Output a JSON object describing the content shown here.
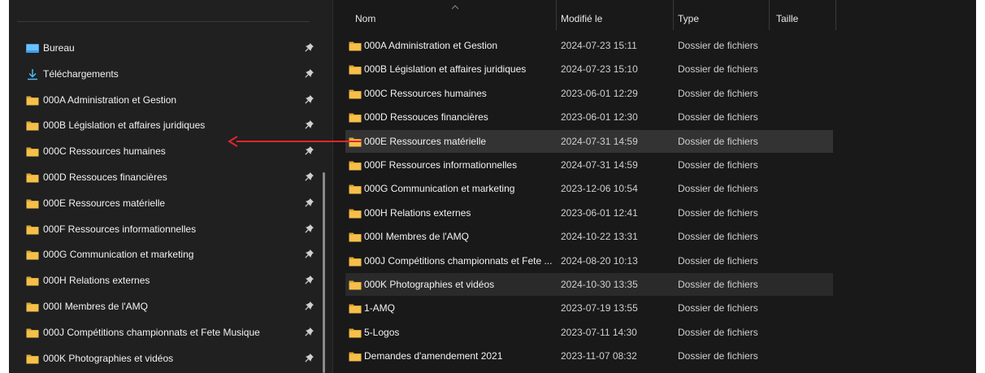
{
  "colors": {
    "folder": "#f5c04a",
    "folder_dark": "#dca734",
    "pin": "#cfcfcf",
    "download": "#4cc2ff",
    "desktop": "#3aa0f0",
    "annotation_arrow": "#e0262b"
  },
  "nav": {
    "items": [
      {
        "label": "Bureau",
        "icon": "desktop-icon"
      },
      {
        "label": "Téléchargements",
        "icon": "download-icon"
      },
      {
        "label": "000A Administration et Gestion",
        "icon": "folder-icon"
      },
      {
        "label": "000B Législation et affaires juridiques",
        "icon": "folder-icon"
      },
      {
        "label": "000C Ressources humaines",
        "icon": "folder-icon"
      },
      {
        "label": "000D Ressouces financières",
        "icon": "folder-icon"
      },
      {
        "label": "000E Ressources matérielle",
        "icon": "folder-icon"
      },
      {
        "label": "000F Ressources informationnelles",
        "icon": "folder-icon"
      },
      {
        "label": "000G Communication et marketing",
        "icon": "folder-icon"
      },
      {
        "label": "000H Relations externes",
        "icon": "folder-icon"
      },
      {
        "label": "000I Membres de l'AMQ",
        "icon": "folder-icon"
      },
      {
        "label": "000J Compétitions championnats et Fete Musique",
        "icon": "folder-icon"
      },
      {
        "label": "000K Photographies et vidéos",
        "icon": "folder-icon"
      }
    ]
  },
  "list": {
    "columns": [
      "Nom",
      "Modifié le",
      "Type",
      "Taille"
    ],
    "rows": [
      {
        "name": "000A Administration et Gestion",
        "modified": "2024-07-23 15:11",
        "type": "Dossier de fichiers"
      },
      {
        "name": "000B Législation et affaires juridiques",
        "modified": "2024-07-23 15:10",
        "type": "Dossier de fichiers"
      },
      {
        "name": "000C Ressources humaines",
        "modified": "2023-06-01 12:29",
        "type": "Dossier de fichiers"
      },
      {
        "name": "000D Ressouces financières",
        "modified": "2023-06-01 12:30",
        "type": "Dossier de fichiers"
      },
      {
        "name": "000E Ressources matérielle",
        "modified": "2024-07-31 14:59",
        "type": "Dossier de fichiers"
      },
      {
        "name": "000F Ressources informationnelles",
        "modified": "2024-07-31 14:59",
        "type": "Dossier de fichiers"
      },
      {
        "name": "000G Communication et marketing",
        "modified": "2023-12-06 10:54",
        "type": "Dossier de fichiers"
      },
      {
        "name": "000H Relations externes",
        "modified": "2023-06-01 12:41",
        "type": "Dossier de fichiers"
      },
      {
        "name": "000I Membres de l'AMQ",
        "modified": "2024-10-22 13:31",
        "type": "Dossier de fichiers"
      },
      {
        "name": "000J Compétitions championnats et Fete ...",
        "modified": "2024-08-20 10:13",
        "type": "Dossier de fichiers"
      },
      {
        "name": "000K Photographies et vidéos",
        "modified": "2024-10-30 13:35",
        "type": "Dossier de fichiers"
      },
      {
        "name": "1-AMQ",
        "modified": "2023-07-19 13:55",
        "type": "Dossier de fichiers"
      },
      {
        "name": "5-Logos",
        "modified": "2023-07-11 14:30",
        "type": "Dossier de fichiers"
      },
      {
        "name": "Demandes d'amendement 2021",
        "modified": "2023-11-07 08:32",
        "type": "Dossier de fichiers"
      }
    ],
    "selected_rows": [
      "000E Ressources matérielle"
    ],
    "highlighted_rows": [
      "000K Photographies et vidéos"
    ]
  }
}
